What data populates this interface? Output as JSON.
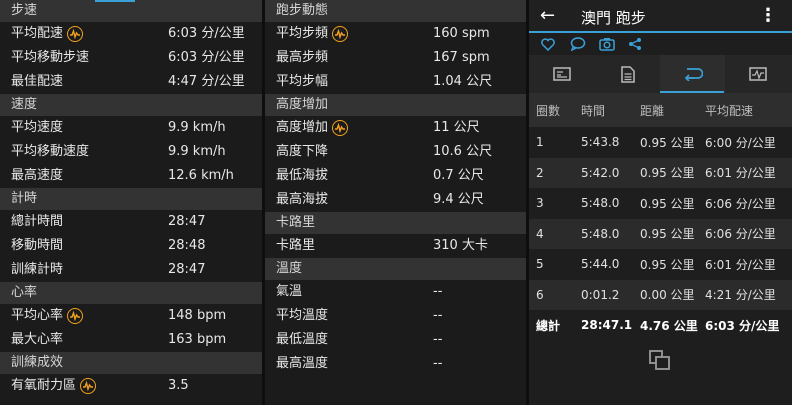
{
  "left": {
    "sections": [
      {
        "title": "步速",
        "rows": [
          {
            "label": "平均配速",
            "value": "6:03 分/公里",
            "icon": "pace-wave-icon"
          },
          {
            "label": "平均移動步速",
            "value": "6:03 分/公里"
          },
          {
            "label": "最佳配速",
            "value": "4:47 分/公里"
          }
        ]
      },
      {
        "title": "速度",
        "rows": [
          {
            "label": "平均速度",
            "value": "9.9 km/h"
          },
          {
            "label": "平均移動速度",
            "value": "9.9 km/h"
          },
          {
            "label": "最高速度",
            "value": "12.6 km/h"
          }
        ]
      },
      {
        "title": "計時",
        "rows": [
          {
            "label": "總計時間",
            "value": "28:47"
          },
          {
            "label": "移動時間",
            "value": "28:48"
          },
          {
            "label": "訓練計時",
            "value": "28:47"
          }
        ]
      },
      {
        "title": "心率",
        "rows": [
          {
            "label": "平均心率",
            "value": "148 bpm",
            "icon": "heart-wave-icon"
          },
          {
            "label": "最大心率",
            "value": "163 bpm"
          }
        ]
      },
      {
        "title": "訓練成效",
        "rows": [
          {
            "label": "有氧耐力區",
            "value": "3.5",
            "icon": "training-wave-icon"
          }
        ]
      }
    ]
  },
  "middle": {
    "sections": [
      {
        "title": "跑步動態",
        "rows": [
          {
            "label": "平均步頻",
            "value": "160 spm",
            "icon": "cadence-wave-icon"
          },
          {
            "label": "最高步頻",
            "value": "167 spm"
          },
          {
            "label": "平均步幅",
            "value": "1.04 公尺"
          }
        ]
      },
      {
        "title": "高度增加",
        "rows": [
          {
            "label": "高度增加",
            "value": "11 公尺",
            "icon": "elevation-wave-icon"
          },
          {
            "label": "高度下降",
            "value": "10.6 公尺"
          },
          {
            "label": "最低海拔",
            "value": "0.7 公尺"
          },
          {
            "label": "最高海拔",
            "value": "9.4 公尺"
          }
        ]
      },
      {
        "title": "卡路里",
        "rows": [
          {
            "label": "卡路里",
            "value": "310 大卡"
          }
        ]
      },
      {
        "title": "溫度",
        "rows": [
          {
            "label": "氣溫",
            "value": "--"
          },
          {
            "label": "平均溫度",
            "value": "--"
          },
          {
            "label": "最低溫度",
            "value": "--"
          },
          {
            "label": "最高溫度",
            "value": "--"
          }
        ]
      }
    ]
  },
  "right": {
    "title": "澳門 跑步",
    "back_icon": "arrow-left-icon",
    "more_icon": "more-vert-icon",
    "actions": [
      "heart-icon",
      "comment-icon",
      "camera-icon",
      "share-icon"
    ],
    "tabs": [
      "summary-tab-icon",
      "details-tab-icon",
      "laps-tab-icon",
      "chart-tab-icon"
    ],
    "active_tab": 2,
    "lap_headers": [
      "圈數",
      "時間",
      "距離",
      "平均配速"
    ],
    "laps": [
      [
        "1",
        "5:43.8",
        "0.95 公里",
        "6:00 分/公里"
      ],
      [
        "2",
        "5:42.0",
        "0.95 公里",
        "6:01 分/公里"
      ],
      [
        "3",
        "5:48.0",
        "0.95 公里",
        "6:06 分/公里"
      ],
      [
        "4",
        "5:48.0",
        "0.95 公里",
        "6:06 分/公里"
      ],
      [
        "5",
        "5:44.0",
        "0.95 公里",
        "6:01 分/公里"
      ],
      [
        "6",
        "0:01.2",
        "0.00 公里",
        "4:21 分/公里"
      ]
    ],
    "total": [
      "總計",
      "28:47.1",
      "4.76 公里",
      "6:03 分/公里"
    ]
  },
  "colors": {
    "accent": "#3aa0d8",
    "icon_orange": "#f4a21c",
    "section_bg": "#333333"
  }
}
